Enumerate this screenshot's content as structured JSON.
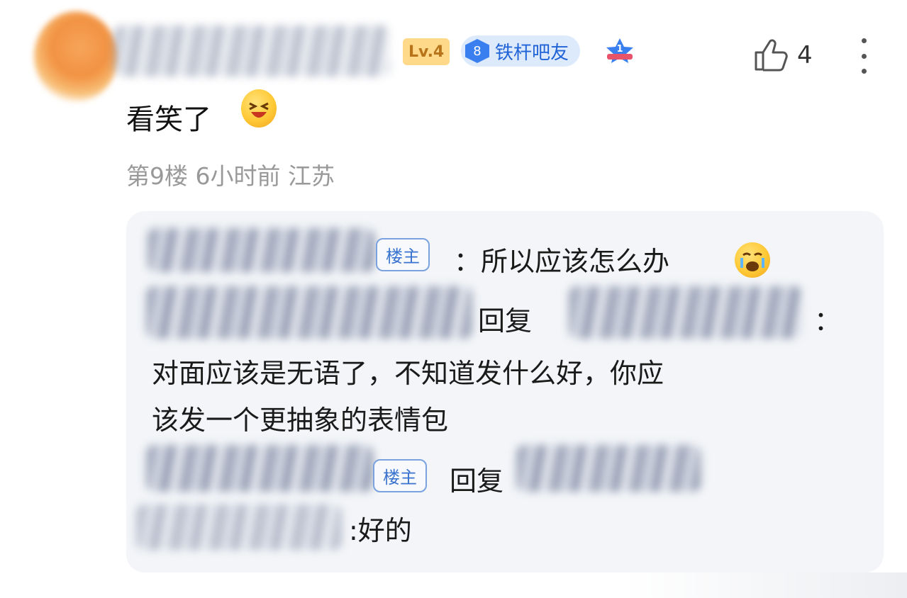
{
  "comment": {
    "level_badge": "Lv.4",
    "fan_badge_level": "8",
    "fan_badge_name": "铁杆吧友",
    "rank_number": "1",
    "like_count": "4",
    "text": "看笑了",
    "meta": "第9楼 6小时前 江苏"
  },
  "replies": [
    {
      "tag": "楼主",
      "text": "：所以应该怎么办"
    },
    {
      "reply_word": "回复",
      "colon": "：",
      "line1": "对面应该是无语了，不知道发什么好，你应",
      "line2": "该发一个更抽象的表情包"
    },
    {
      "tag": "楼主",
      "reply_word": "回复",
      "text": ":好的"
    }
  ],
  "colors": {
    "accent_blue": "#3b74cf",
    "level_gold": "#ffd98a",
    "panel_bg": "#f3f5f8",
    "meta_gray": "#999999"
  },
  "icons": [
    "laughing-emoji-icon",
    "crying-emoji-icon",
    "thumbs-up-icon",
    "more-vertical-icon",
    "rank-star-icon"
  ]
}
